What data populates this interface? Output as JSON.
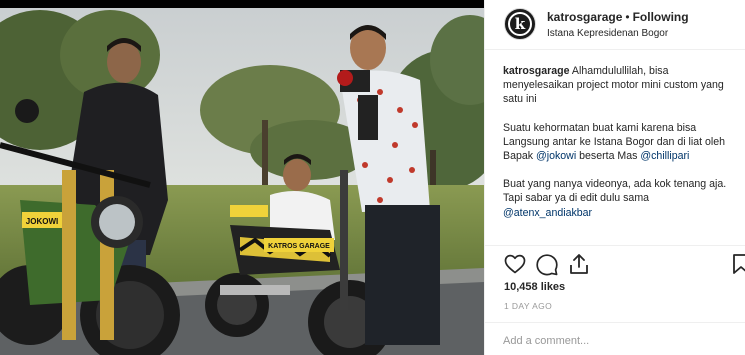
{
  "post": {
    "username": "katrosgarage",
    "separator": "•",
    "follow_state": "Following",
    "location": "Istana Kepresidenan Bogor",
    "avatar_letter": "k"
  },
  "caption": {
    "username": "katrosgarage",
    "line1": "Alhamdulullilah, bisa menyelesaikan project motor mini custom yang satu ini",
    "para2_a": "Suatu kehormatan buat kami karena bisa Langsung antar ke Istana Bogor dan di liat oleh Bapak ",
    "mention_jokowi": "@jokowi",
    "para2_b": " beserta Mas ",
    "mention_chillipari": "@chillipari",
    "para3": "Buat yang nanya videonya, ada kok tenang aja. Tapi sabar ya di edit dulu sama ",
    "mention_atenx": "@atenx_andiakbar"
  },
  "actions": {
    "like_icon": "heart-icon",
    "comment_icon": "comment-bubble-icon",
    "share_icon": "share-icon",
    "save_icon": "bookmark-icon"
  },
  "likes": "10,458 likes",
  "time": "1 DAY AGO",
  "comment_box": {
    "placeholder": "Add a comment..."
  },
  "plates": {
    "left": "JOKOWI",
    "right_front": "KATROS GARAGE"
  },
  "colors": {
    "link": "#003569",
    "muted": "#999999",
    "text": "#262626",
    "border": "#efefef"
  }
}
